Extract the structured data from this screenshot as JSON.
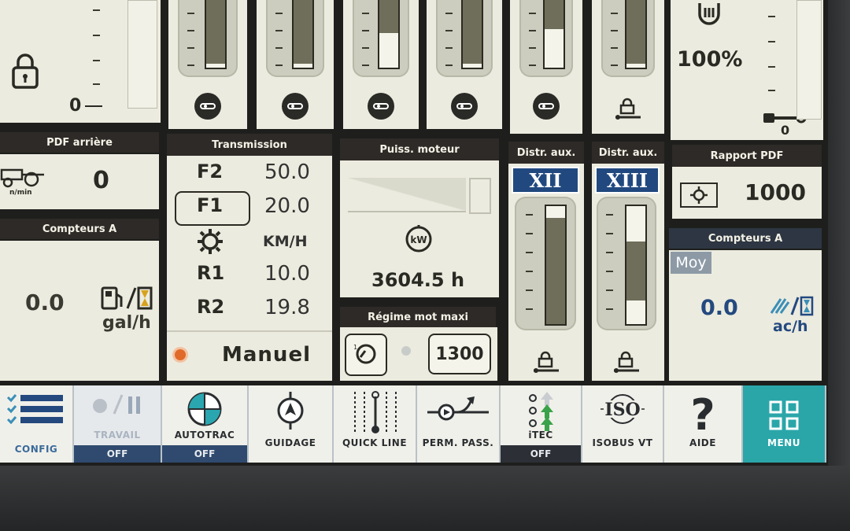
{
  "top_lock_scale_zero": "0",
  "pct_gauge_value": "100%",
  "pct_gauge_zero": "0",
  "pdf_arriere": {
    "header": "PDF arrière",
    "unit": "n/min",
    "value": "0"
  },
  "compteurs_left": {
    "header": "Compteurs A",
    "value": "0.0",
    "unit": "gal/h"
  },
  "transmission": {
    "header": "Transmission",
    "rows": [
      {
        "label": "F2",
        "value": "50.0"
      },
      {
        "label": "F1",
        "value": "20.0"
      },
      {
        "label": "",
        "value": "KM/H"
      },
      {
        "label": "R1",
        "value": "10.0"
      },
      {
        "label": "R2",
        "value": "19.8"
      }
    ],
    "mode": "Manuel"
  },
  "puissance": {
    "header": "Puiss. moteur",
    "unit_icon": "kW",
    "hours": "3604.5 h"
  },
  "regime": {
    "header": "Régime mot maxi",
    "value": "1300"
  },
  "distr_left": {
    "header": "Distr. aux.",
    "label": "XII",
    "fill_fraction": 0.9
  },
  "distr_right": {
    "header": "Distr. aux.",
    "label": "XIII",
    "fill_fraction": 0.5
  },
  "rapport_pdf": {
    "header": "Rapport PDF",
    "value": "1000"
  },
  "compteurs_right": {
    "header": "Compteurs A",
    "tag": "Moy",
    "value": "0.0",
    "unit": "ac/h"
  },
  "top_gauges": [
    {
      "fill_fraction": 0.95
    },
    {
      "fill_fraction": 0.95
    },
    {
      "fill_fraction": 0.55
    },
    {
      "fill_fraction": 0.95
    },
    {
      "fill_fraction": 0.5
    },
    {
      "fill_fraction": 0.95
    }
  ],
  "toolbar": [
    {
      "label": "CONFIG",
      "state": ""
    },
    {
      "label": "TRAVAIL",
      "state": "OFF"
    },
    {
      "label": "AUTOTRAC",
      "state": "OFF"
    },
    {
      "label": "GUIDAGE",
      "state": ""
    },
    {
      "label": "QUICK LINE",
      "state": ""
    },
    {
      "label": "PERM. PASS.",
      "state": ""
    },
    {
      "label": "iTEC",
      "state": "OFF"
    },
    {
      "label": "ISOBUS VT",
      "state": "",
      "logo": "ISO"
    },
    {
      "label": "AIDE",
      "state": "",
      "glyph": "?"
    },
    {
      "label": "MENU",
      "state": ""
    }
  ],
  "colors": {
    "accent_blue": "#21497f",
    "menu_teal": "#2aa6a9",
    "panel_bg": "#ecebdf",
    "header_dark": "#2d2a27"
  }
}
